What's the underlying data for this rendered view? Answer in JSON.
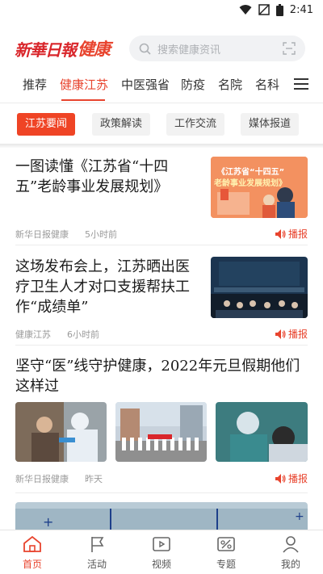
{
  "status_bar": {
    "time": "2:41"
  },
  "header": {
    "logo_text": "新華日報",
    "logo_health": "健康",
    "search_placeholder": "搜索健康资讯"
  },
  "nav": {
    "tabs": [
      {
        "label": "推荐",
        "active": false
      },
      {
        "label": "健康江苏",
        "active": true
      },
      {
        "label": "中医强省",
        "active": false
      },
      {
        "label": "防疫",
        "active": false
      },
      {
        "label": "名院",
        "active": false
      },
      {
        "label": "名科",
        "active": false
      }
    ]
  },
  "subtabs": [
    {
      "label": "江苏要闻",
      "active": true
    },
    {
      "label": "政策解读",
      "active": false
    },
    {
      "label": "工作交流",
      "active": false
    },
    {
      "label": "媒体报道",
      "active": false
    }
  ],
  "articles": [
    {
      "title": "一图读懂《江苏省“十四五”老龄事业发展规划》",
      "thumb_caption_1": "《江苏省“十四五”",
      "thumb_caption_2": "老龄事业发展规划》",
      "source": "新华日报健康",
      "time": "5小时前",
      "play_label": "播报"
    },
    {
      "title": "这场发布会上，江苏晒出医疗卫生人才对口支援帮扶工作“成绩单”",
      "source": "健康江苏",
      "time": "6小时前",
      "play_label": "播报"
    },
    {
      "title": "坚守“医”线守护健康，2022年元旦假期他们这样过",
      "source": "新华日报健康",
      "time": "昨天",
      "play_label": "播报"
    }
  ],
  "bottom_nav": [
    {
      "label": "首页",
      "icon": "home-icon",
      "active": true
    },
    {
      "label": "活动",
      "icon": "flag-icon",
      "active": false
    },
    {
      "label": "视频",
      "icon": "video-icon",
      "active": false
    },
    {
      "label": "专题",
      "icon": "topic-icon",
      "active": false
    },
    {
      "label": "我的",
      "icon": "user-icon",
      "active": false
    }
  ],
  "colors": {
    "accent": "#e8442e",
    "chip_active": "#ef4425"
  }
}
